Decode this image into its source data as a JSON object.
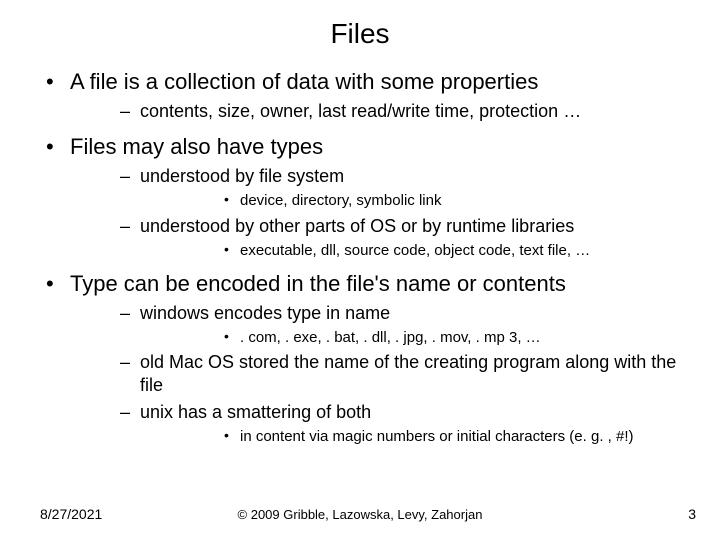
{
  "title": "Files",
  "bullets": {
    "b1": "A file is a collection of data with some properties",
    "b1a": "contents, size, owner, last read/write time, protection …",
    "b2": "Files may also have types",
    "b2a": "understood by file system",
    "b2a1": "device, directory, symbolic link",
    "b2b": "understood by other parts of OS or by runtime libraries",
    "b2b1": "executable, dll, source code, object code, text file, …",
    "b3": "Type can be encoded in the file's name or contents",
    "b3a": "windows encodes type in name",
    "b3a1": ". com, . exe, . bat, . dll, . jpg, . mov, . mp 3, …",
    "b3b": "old Mac OS stored the name of the creating program along with the file",
    "b3c": "unix has a smattering of both",
    "b3c1": "in content via magic numbers or initial characters (e. g. , #!)"
  },
  "footer": {
    "date": "8/27/2021",
    "copyright": "© 2009 Gribble, Lazowska, Levy, Zahorjan",
    "page": "3"
  }
}
